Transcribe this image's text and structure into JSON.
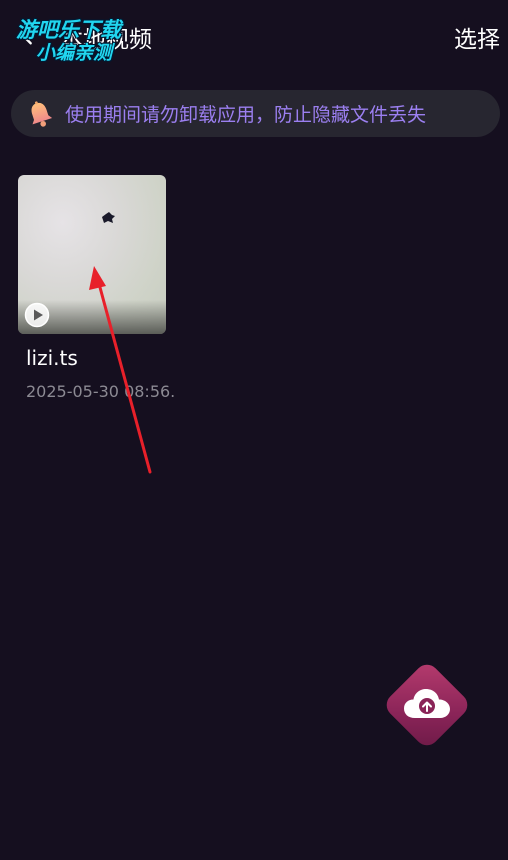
{
  "header": {
    "title": "本地视频",
    "select_label": "选择"
  },
  "watermark": {
    "line1": "游吧乐下载",
    "line2": "小编亲测"
  },
  "notice": {
    "text": "使用期间请勿卸载应用，防止隐藏文件丢失",
    "icon": "bell-icon"
  },
  "videos": [
    {
      "name": "lizi.ts",
      "date": "2025-05-30 08:56."
    }
  ],
  "colors": {
    "background": "#150f1f",
    "notice_background": "#272630",
    "notice_text": "#9b7ff0",
    "fab": "#9a2b5f",
    "annotation_arrow": "#e8202a"
  }
}
